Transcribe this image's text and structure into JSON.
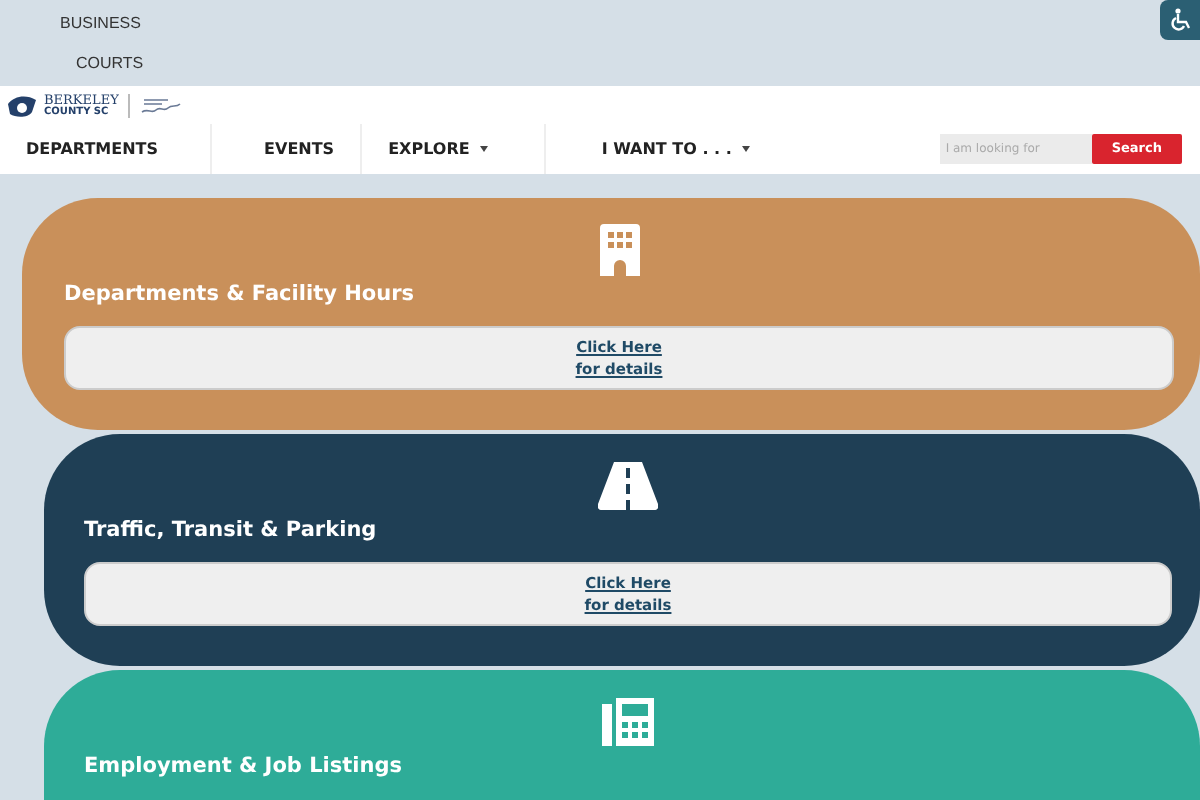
{
  "top_links": [
    "BUSINESS",
    "COURTS"
  ],
  "logo": {
    "name": "BERKELEY",
    "sub": "COUNTY SC"
  },
  "nav": [
    {
      "label": "DEPARTMENTS",
      "dropdown": false
    },
    {
      "label": "EVENTS",
      "dropdown": false
    },
    {
      "label": "EXPLORE",
      "dropdown": true
    },
    {
      "label": "I WANT TO . . .",
      "dropdown": true
    }
  ],
  "search": {
    "placeholder": "I am looking for",
    "button": "Search"
  },
  "cards": [
    {
      "title": "Departments & Facility Hours",
      "color": "#c9905a",
      "kind": "building",
      "link": [
        "Click Here",
        "for details"
      ]
    },
    {
      "title": "Traffic, Transit & Parking",
      "color": "#1f3f55",
      "kind": "road",
      "link": [
        "Click Here",
        "for details"
      ]
    },
    {
      "title": "Employment & Job Listings",
      "color": "#2eac98",
      "kind": "fax"
    }
  ]
}
